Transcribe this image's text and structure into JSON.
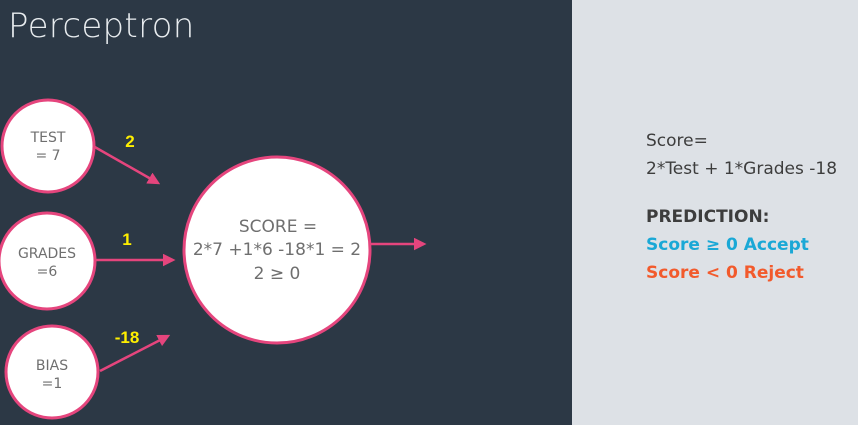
{
  "title": "Perceptron",
  "nodes": {
    "test": {
      "line1": "TEST",
      "line2": "= 7"
    },
    "grades": {
      "line1": "GRADES",
      "line2": "=6"
    },
    "bias": {
      "line1": "BIAS",
      "line2": "=1"
    },
    "score": {
      "line1": "SCORE =",
      "line2": "2*7 +1*6 -18*1 = 2",
      "line3": "2 ≥ 0"
    }
  },
  "weights": {
    "test": "2",
    "grades": "1",
    "bias": "-18"
  },
  "info": {
    "score_label": "Score=",
    "score_formula": "2*Test + 1*Grades -18",
    "prediction_heading": "PREDICTION:",
    "accept_rule": "Score ≥ 0 Accept",
    "reject_rule": "Score < 0 Reject"
  },
  "colors": {
    "left_background": "#2c3845",
    "right_background": "#dde1e6",
    "edge_pink": "#e5457d",
    "weight_yellow": "#ffef00",
    "accept_blue": "#1aa8d6",
    "reject_orange": "#f25a2c"
  }
}
